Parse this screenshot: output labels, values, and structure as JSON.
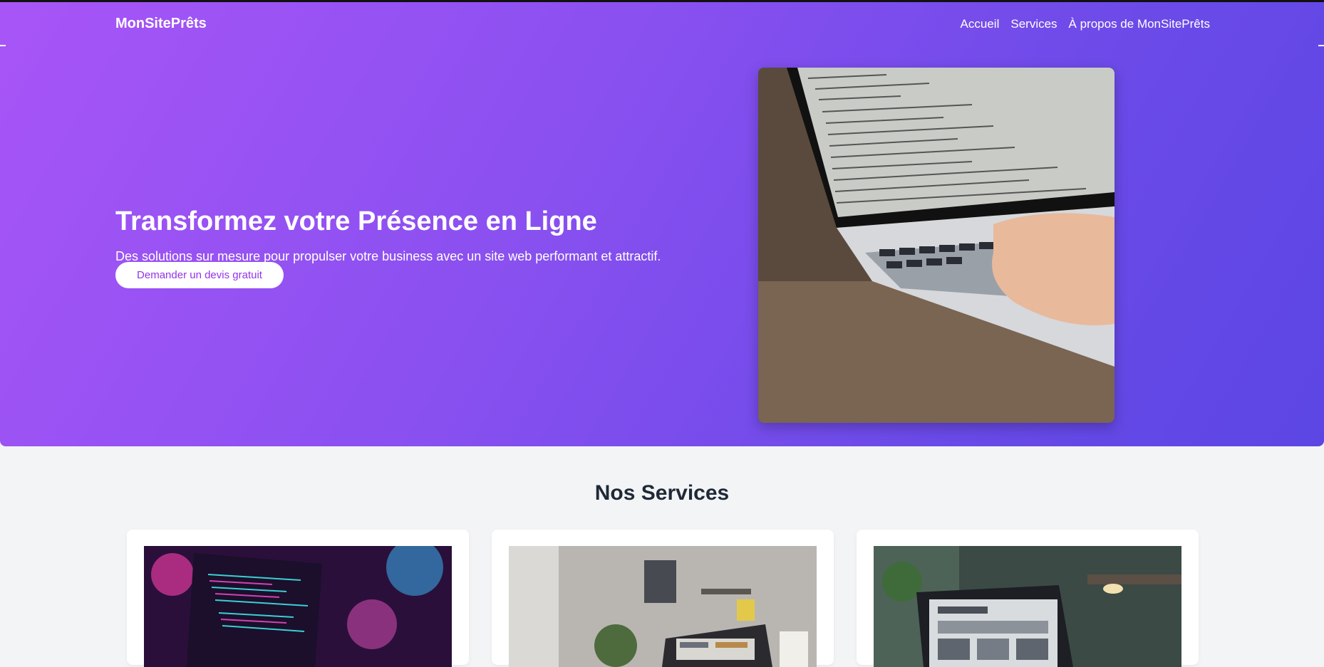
{
  "brand": "MonSitePrêts",
  "nav": {
    "items": [
      "Accueil",
      "Services",
      "À propos de MonSitePrêts"
    ]
  },
  "hero": {
    "title": "Transformez votre Présence en Ligne",
    "subtitle": "Des solutions sur mesure pour propulser votre business avec un site web performant et attractif.",
    "cta_label": "Demander un devis gratuit",
    "image": "laptop-code-photo"
  },
  "services": {
    "title": "Nos Services",
    "cards": [
      {
        "image": "neon-laptop-code-photo"
      },
      {
        "image": "office-laptop-photo"
      },
      {
        "image": "desk-laptop-website-photo"
      }
    ]
  },
  "colors": {
    "gradient_start": "#a855f7",
    "gradient_end": "#5b46e4",
    "cta_text": "#9333ea",
    "page_background": "#f3f4f6"
  }
}
